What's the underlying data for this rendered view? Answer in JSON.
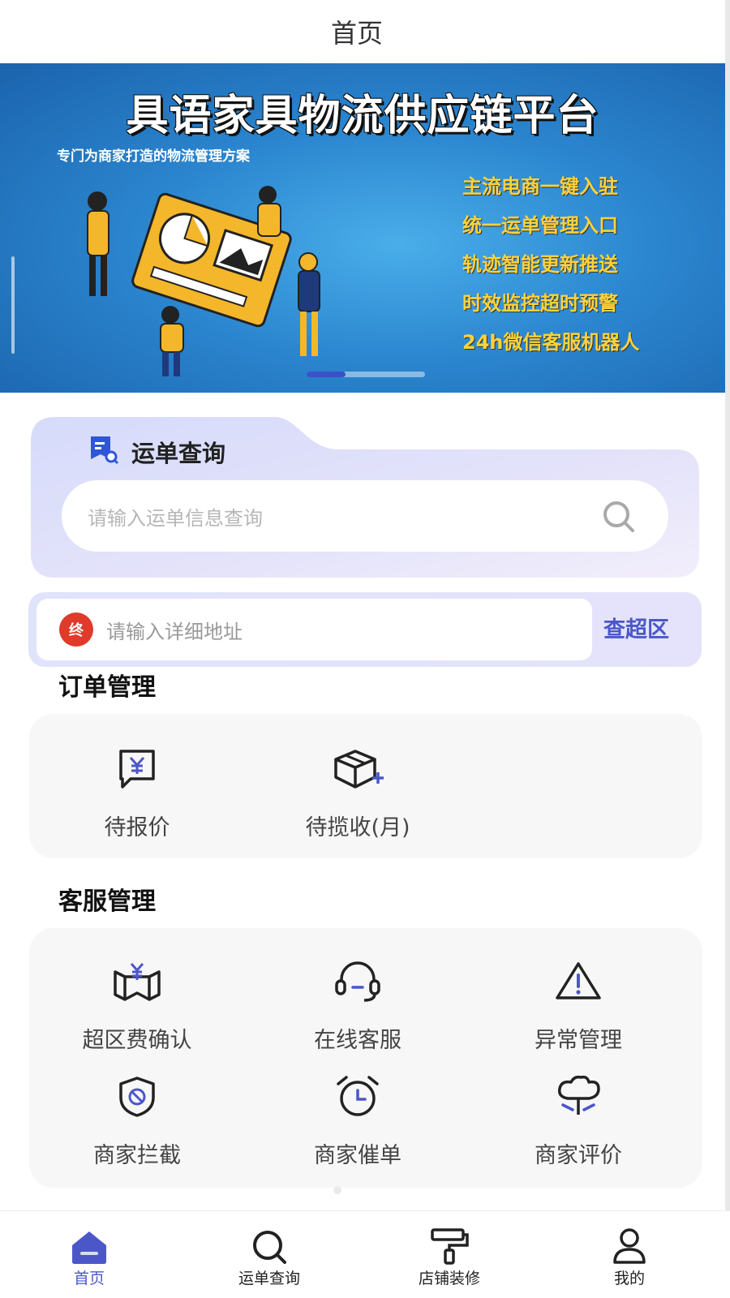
{
  "header": {
    "title": "首页"
  },
  "banner": {
    "headline": "具语家具物流供应链平台",
    "subline": "专门为商家打造的物流管理方案",
    "features": [
      "主流电商一键入驻",
      "统一运单管理入口",
      "轨迹智能更新推送",
      "时效监控超时预警",
      "24h微信客服机器人"
    ]
  },
  "waybill_query": {
    "title": "运单查询",
    "search_placeholder": "请输入运单信息查询"
  },
  "address": {
    "badge": "终",
    "placeholder": "请输入详细地址",
    "button": "查超区"
  },
  "order_management": {
    "title": "订单管理",
    "items": [
      {
        "label": "待报价",
        "icon": "quote-icon"
      },
      {
        "label": "待揽收(月)",
        "icon": "package-add-icon"
      }
    ]
  },
  "customer_service": {
    "title": "客服管理",
    "items": [
      {
        "label": "超区费确认",
        "icon": "fee-map-icon"
      },
      {
        "label": "在线客服",
        "icon": "headset-icon"
      },
      {
        "label": "异常管理",
        "icon": "warning-icon"
      },
      {
        "label": "商家拦截",
        "icon": "shield-block-icon"
      },
      {
        "label": "商家催单",
        "icon": "alarm-clock-icon"
      },
      {
        "label": "商家评价",
        "icon": "flower-icon"
      }
    ]
  },
  "tabbar": [
    {
      "label": "首页",
      "icon": "home-icon",
      "active": true
    },
    {
      "label": "运单查询",
      "icon": "search-icon",
      "active": false
    },
    {
      "label": "店铺装修",
      "icon": "paint-roller-icon",
      "active": false
    },
    {
      "label": "我的",
      "icon": "user-icon",
      "active": false
    }
  ],
  "colors": {
    "accent": "#4b57c9",
    "banner_text": "#ffd23a",
    "badge": "#e03a2b"
  }
}
